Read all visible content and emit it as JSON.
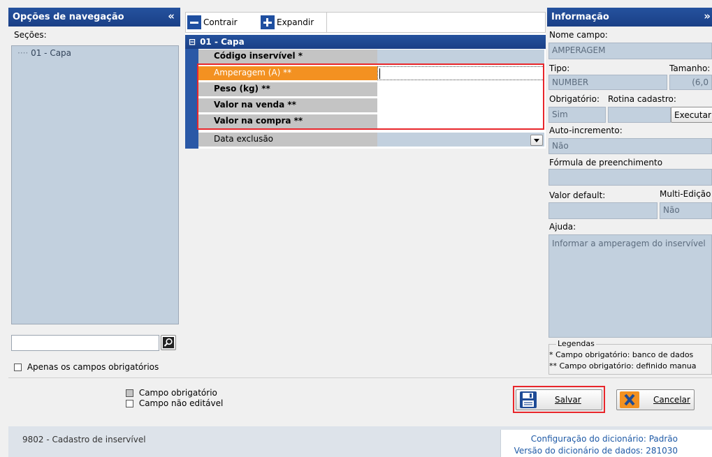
{
  "nav": {
    "title": "Opções de navegação",
    "collapse_glyph": "«",
    "sections_label": "Seções:",
    "tree_item": "01 - Capa",
    "search_value": "",
    "only_required_label": "Apenas os campos obrigatórios"
  },
  "toolbar": {
    "collapse_label": "Contrair",
    "expand_label": "Expandir"
  },
  "grid": {
    "group_title": "01 - Capa",
    "group_toggle": "⊟",
    "rows": [
      {
        "label": "Código inservível *",
        "value": ""
      },
      {
        "label": "Amperagem (A) **",
        "value": ""
      },
      {
        "label": "Peso (kg) **",
        "value": ""
      },
      {
        "label": "Valor na venda **",
        "value": ""
      },
      {
        "label": "Valor na compra **",
        "value": ""
      },
      {
        "label": "Data exclusão",
        "value": ""
      }
    ]
  },
  "info": {
    "title": "Informação",
    "expand_glyph": "»",
    "field_name_label": "Nome campo:",
    "field_name_value": "AMPERAGEM",
    "type_label": "Tipo:",
    "type_value": "NUMBER",
    "size_label": "Tamanho:",
    "size_value": "(6,0",
    "required_label": "Obrigatório:",
    "required_value": "Sim",
    "routine_label": "Rotina cadastro:",
    "execute_label": "Executar",
    "autoinc_label": "Auto-incremento:",
    "autoinc_value": "Não",
    "formula_label": "Fórmula de preenchimento",
    "formula_value": "",
    "default_label": "Valor default:",
    "default_value": "",
    "multiedit_label": "Multi-Edição",
    "multiedit_value": "Não",
    "help_label": "Ajuda:",
    "help_text": "Informar a amperagem do inservível",
    "legend_title": "Legendas",
    "legend_line1": "* Campo obrigatório: banco de dados",
    "legend_line2": "** Campo obrigatório: definido manua"
  },
  "bottom": {
    "legend_required": "Campo obrigatório",
    "legend_not_editable": "Campo não editável",
    "save_label": "Salvar",
    "cancel_label": "Cancelar"
  },
  "status": {
    "screen_name": "9802 - Cadastro de inservível",
    "config_label": "Configuração do dicionário:",
    "config_value": "Padrão",
    "version_label": "Versão do dicionário de dados:",
    "version_value": "281030"
  },
  "colors": {
    "header_blue": "#1a3f86",
    "selected_orange": "#f39121",
    "highlight_red": "#e8262b",
    "panel_bg": "#c2d0de",
    "link_blue": "#1f5aa6"
  }
}
